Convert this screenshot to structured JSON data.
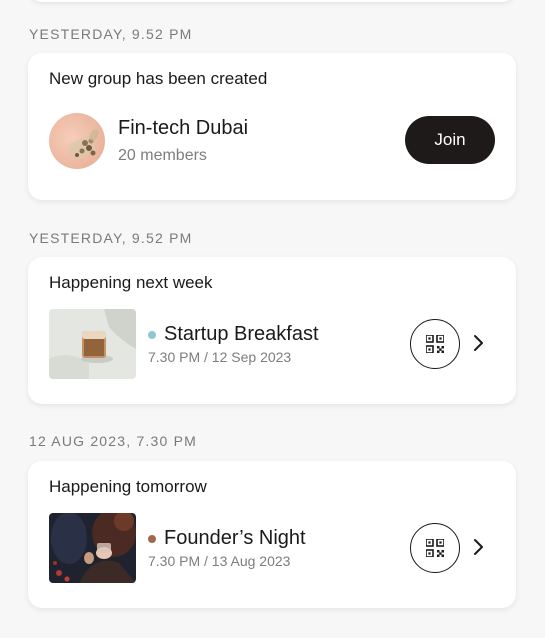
{
  "colors": {
    "join_bg": "#1e1a1a",
    "startup_dot": "#8fc6d3",
    "founders_dot": "#a0674f"
  },
  "group_section": {
    "date": "YESTERDAY, 9.52 PM",
    "title": "New group has been created",
    "group_name": "Fin-tech Dubai",
    "members": "20 members",
    "join_label": "Join"
  },
  "event_sections": [
    {
      "date": "YESTERDAY, 9.52 PM",
      "title": "Happening next week",
      "event_name": "Startup Breakfast",
      "event_time": "7.30 PM / 12 Sep 2023",
      "icons": [
        "qr-code-icon",
        "chevron-right-icon"
      ]
    },
    {
      "date": "12 AUG 2023, 7.30 PM",
      "title": "Happening tomorrow",
      "event_name": "Founder’s Night",
      "event_time": "7.30 PM / 13 Aug 2023",
      "icons": [
        "qr-code-icon",
        "chevron-right-icon"
      ]
    }
  ]
}
